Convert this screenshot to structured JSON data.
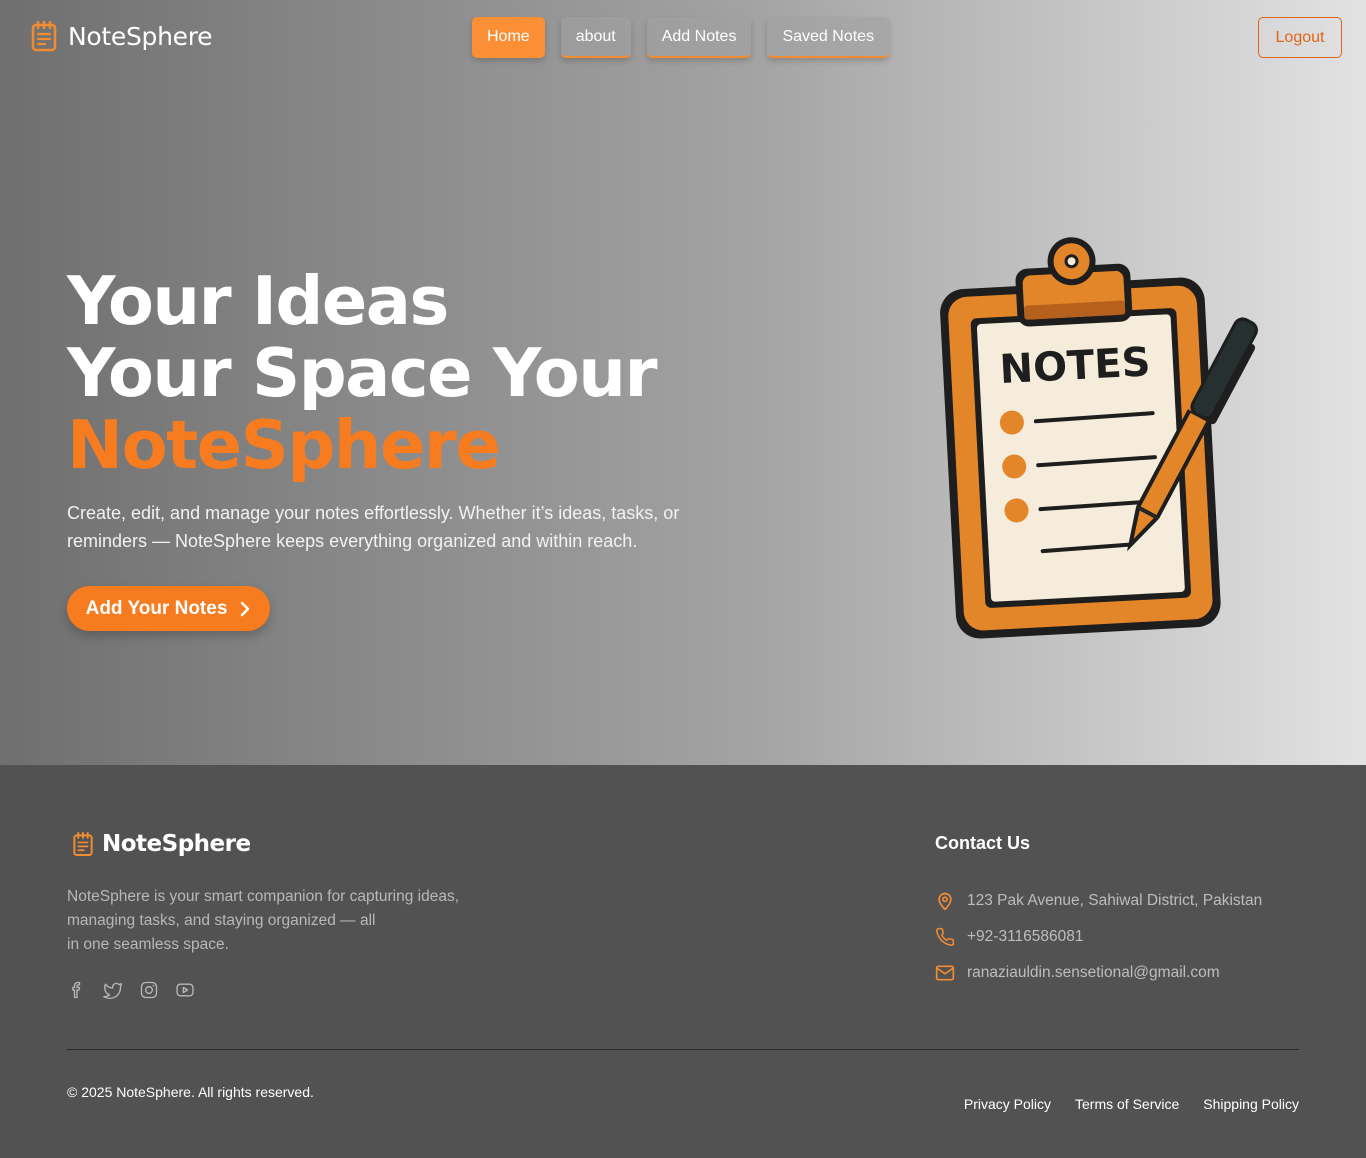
{
  "header": {
    "brand": "NoteSphere",
    "nav": [
      {
        "label": "Home",
        "active": true
      },
      {
        "label": "about",
        "active": false
      },
      {
        "label": "Add Notes",
        "active": false
      },
      {
        "label": "Saved Notes",
        "active": false
      }
    ],
    "logout_label": "Logout"
  },
  "hero": {
    "line1": "Your Ideas",
    "line2": "Your Space Your",
    "line3_accent": "NoteSphere",
    "description": "Create, edit, and manage your notes effortlessly. Whether it’s ideas, tasks, or reminders — NoteSphere keeps everything organized and within reach.",
    "cta_label": "Add Your Notes",
    "illustration_text": "NOTES"
  },
  "footer": {
    "brand": "NoteSphere",
    "description_line1": "NoteSphere is your smart companion for capturing ideas,",
    "description_line2": "managing tasks, and staying organized — all",
    "description_line3": "in one seamless space.",
    "socials": [
      "facebook-icon",
      "twitter-icon",
      "instagram-icon",
      "youtube-icon"
    ],
    "contact_title": "Contact Us",
    "address": "123 Pak Avenue, Sahiwal District, Pakistan",
    "phone": "+92-3116586081",
    "email": "ranaziauldin.sensetional@gmail.com",
    "copyright": "© 2025 NoteSphere. All rights reserved.",
    "legal": [
      "Privacy Policy",
      "Terms of Service",
      "Shipping Policy"
    ]
  },
  "colors": {
    "accent": "#f77b1f",
    "footer_bg": "#525252"
  }
}
